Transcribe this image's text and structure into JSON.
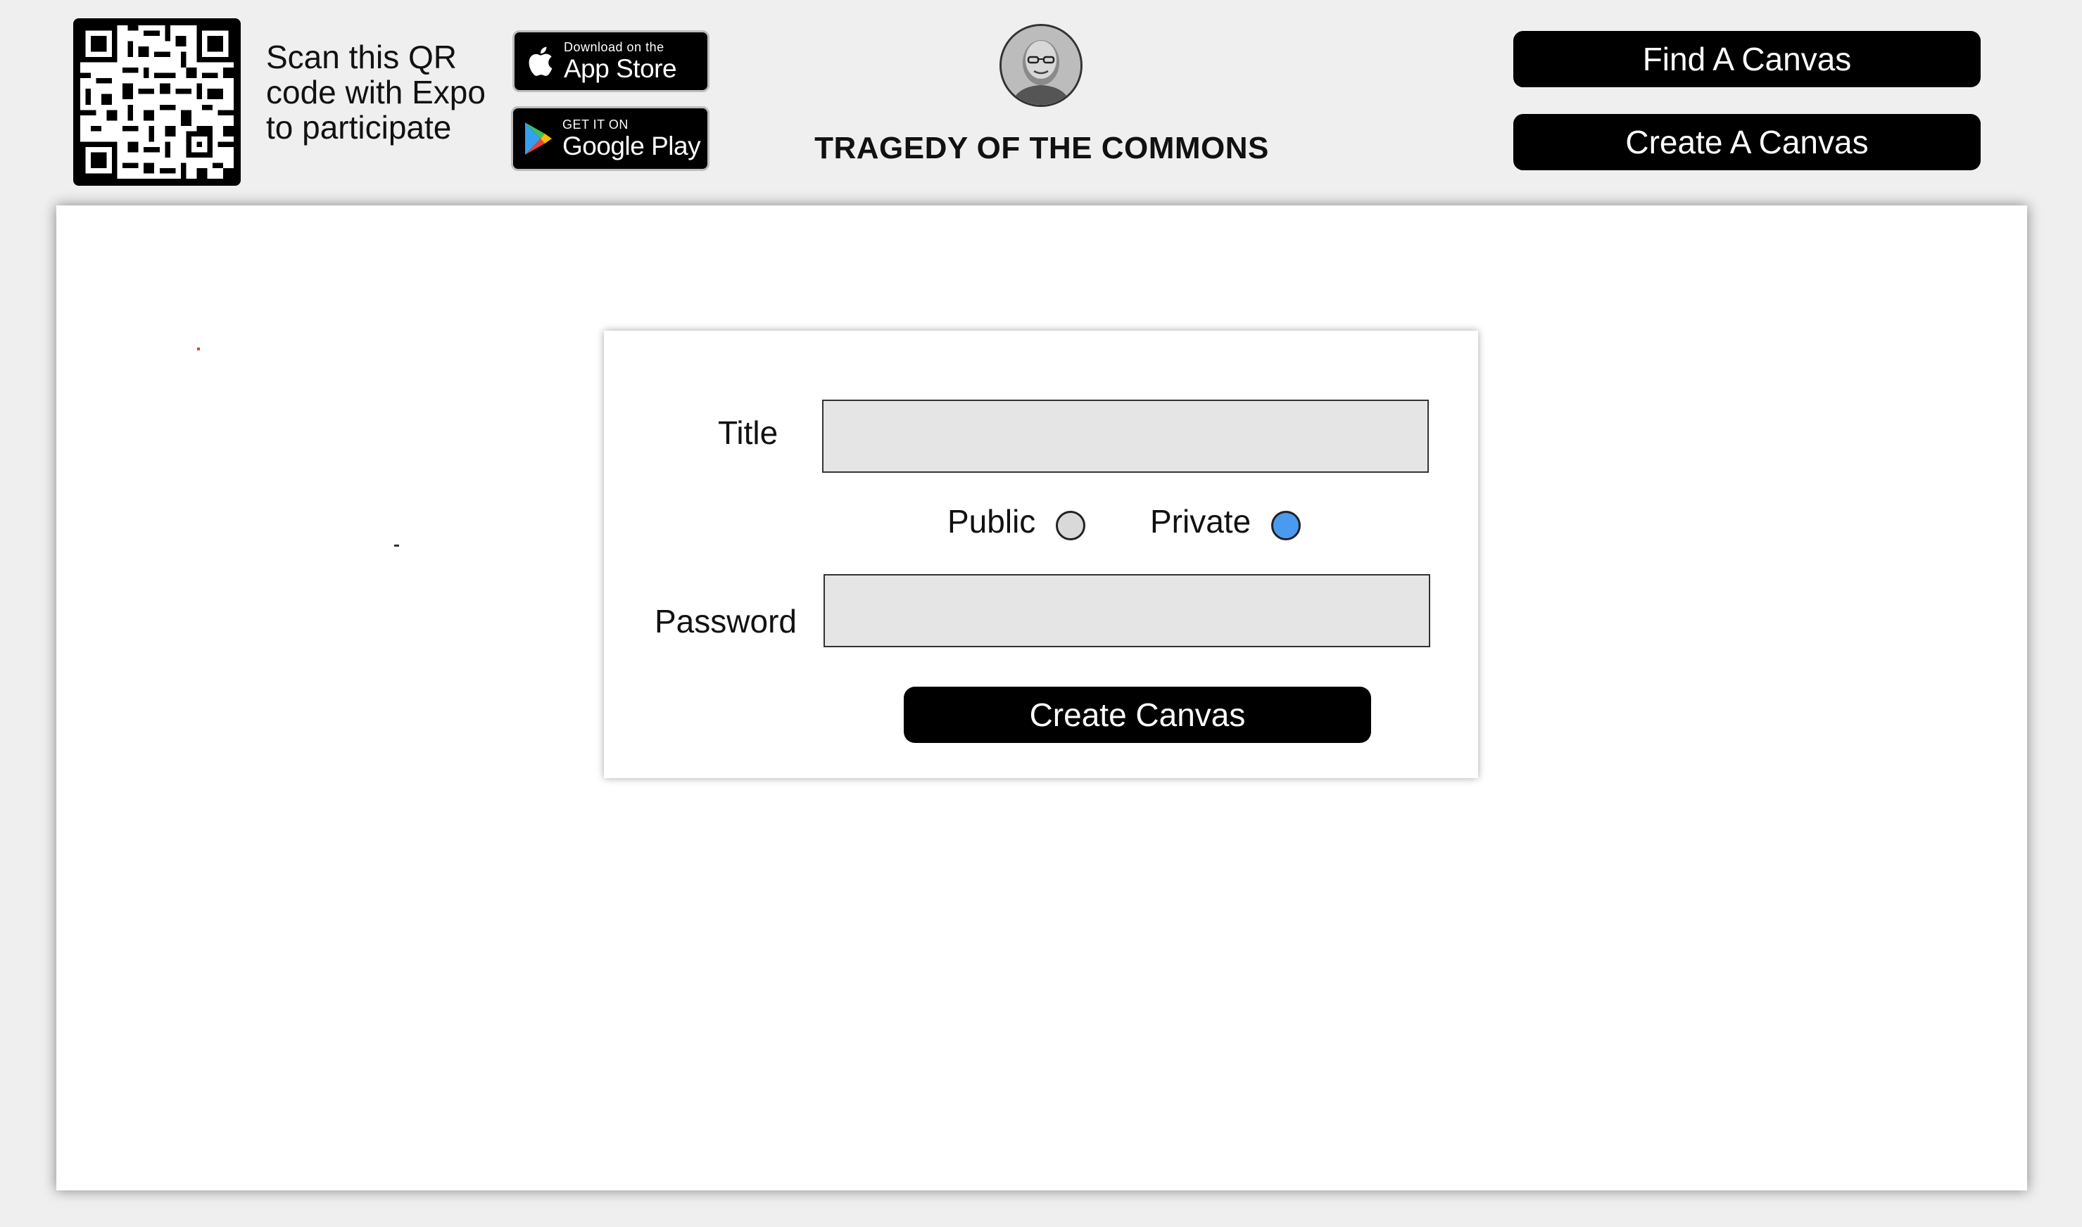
{
  "header": {
    "qr_instruction": "Scan this QR code with Expo to participate",
    "app_store": {
      "small": "Download on the",
      "big": "App Store"
    },
    "google_play": {
      "small": "GET IT ON",
      "big": "Google Play"
    },
    "title": "TRAGEDY OF THE COMMONS",
    "find_button": "Find A Canvas",
    "create_button": "Create A Canvas"
  },
  "form": {
    "title_label": "Title",
    "title_value": "",
    "visibility": {
      "public_label": "Public",
      "private_label": "Private",
      "selected": "Private"
    },
    "password_label": "Password",
    "password_value": "",
    "submit_label": "Create Canvas"
  },
  "colors": {
    "radio_selected": "#4a9af0",
    "radio_unselected": "#d9d9d9",
    "button_bg": "#000000",
    "page_bg": "#efefef"
  }
}
